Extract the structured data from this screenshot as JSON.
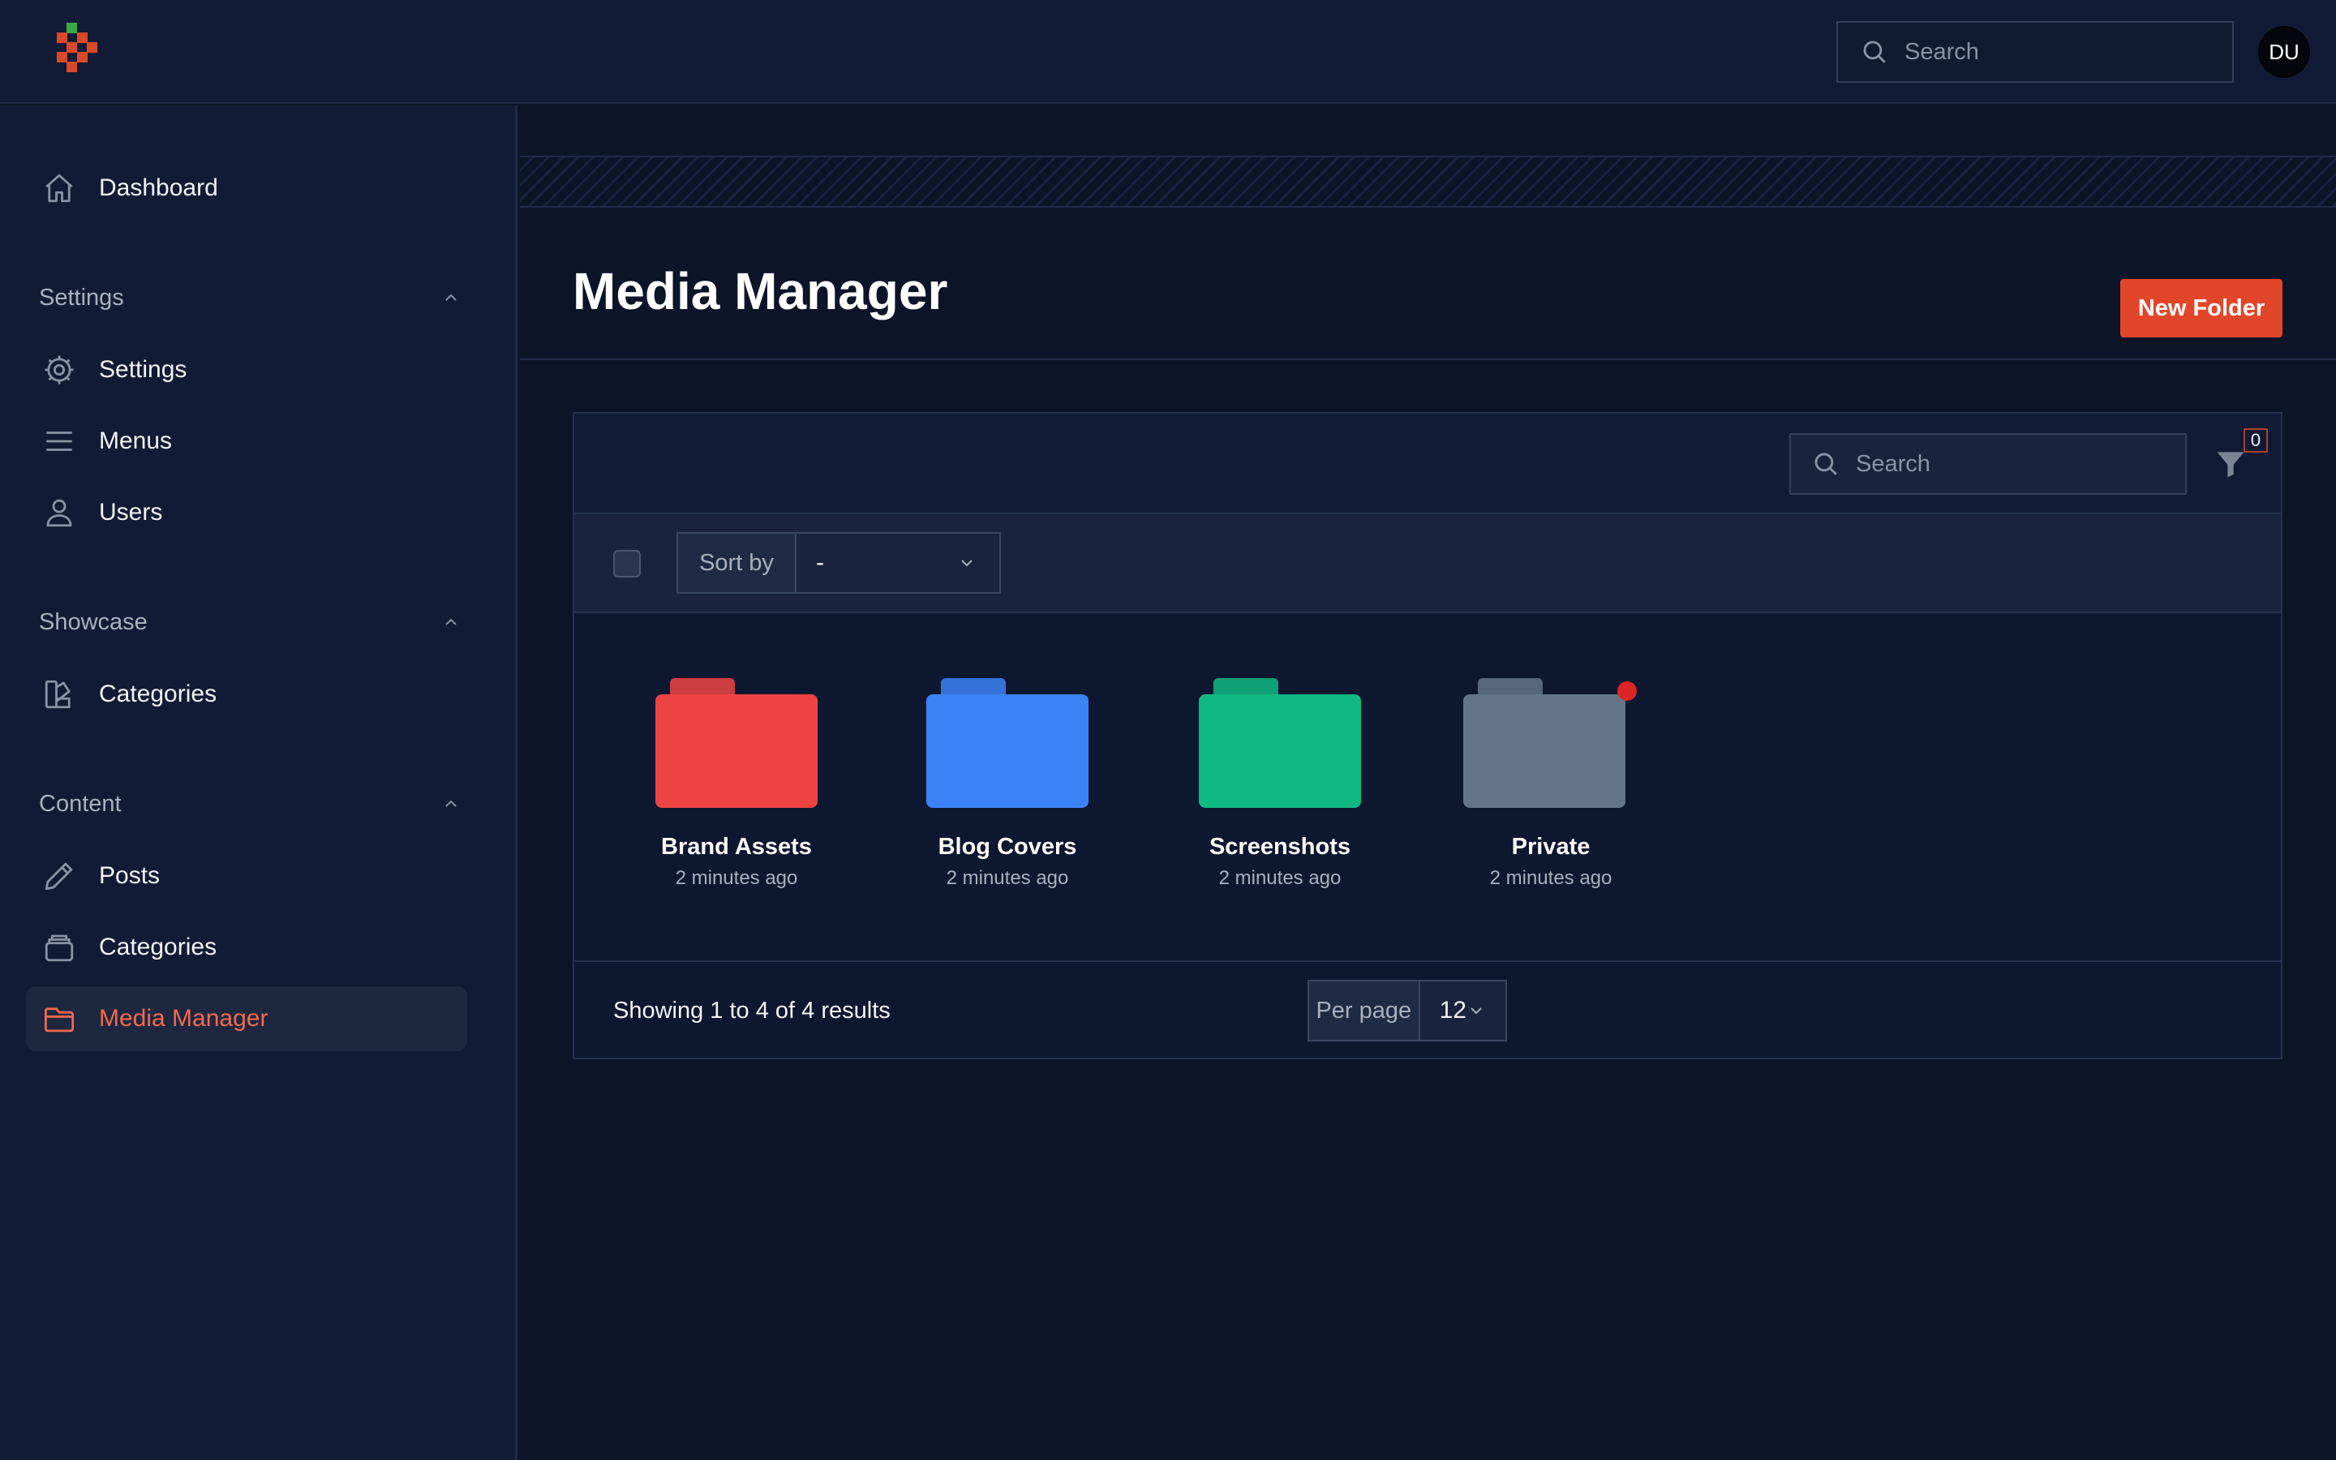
{
  "topbar": {
    "search_placeholder": "Search",
    "avatar_initials": "DU"
  },
  "sidebar": {
    "dashboard": {
      "label": "Dashboard",
      "icon": "home-icon"
    },
    "groups": [
      {
        "label": "Settings",
        "items": [
          {
            "label": "Settings",
            "icon": "gear-icon"
          },
          {
            "label": "Menus",
            "icon": "menu-icon"
          },
          {
            "label": "Users",
            "icon": "user-icon"
          }
        ]
      },
      {
        "label": "Showcase",
        "items": [
          {
            "label": "Categories",
            "icon": "swatch-icon"
          }
        ]
      },
      {
        "label": "Content",
        "items": [
          {
            "label": "Posts",
            "icon": "pencil-icon"
          },
          {
            "label": "Categories",
            "icon": "stack-icon"
          },
          {
            "label": "Media Manager",
            "icon": "folder-icon",
            "active": true
          }
        ]
      }
    ]
  },
  "page": {
    "title": "Media Manager",
    "new_folder_label": "New Folder"
  },
  "table": {
    "search_placeholder": "Search",
    "filter_count": "0",
    "sort_label": "Sort by",
    "sort_value": "-",
    "folders": [
      {
        "name": "Brand Assets",
        "time": "2 minutes ago",
        "color": "#ef4444"
      },
      {
        "name": "Blog Covers",
        "time": "2 minutes ago",
        "color": "#3b82f6"
      },
      {
        "name": "Screenshots",
        "time": "2 minutes ago",
        "color": "#10b981"
      },
      {
        "name": "Private",
        "time": "2 minutes ago",
        "color": "#64748b",
        "private": true
      }
    ],
    "results_text": "Showing 1 to 4 of 4 results",
    "per_page_label": "Per page",
    "per_page_value": "12"
  },
  "colors": {
    "accent": "#e2462a",
    "private_dot": "#dc2626"
  }
}
